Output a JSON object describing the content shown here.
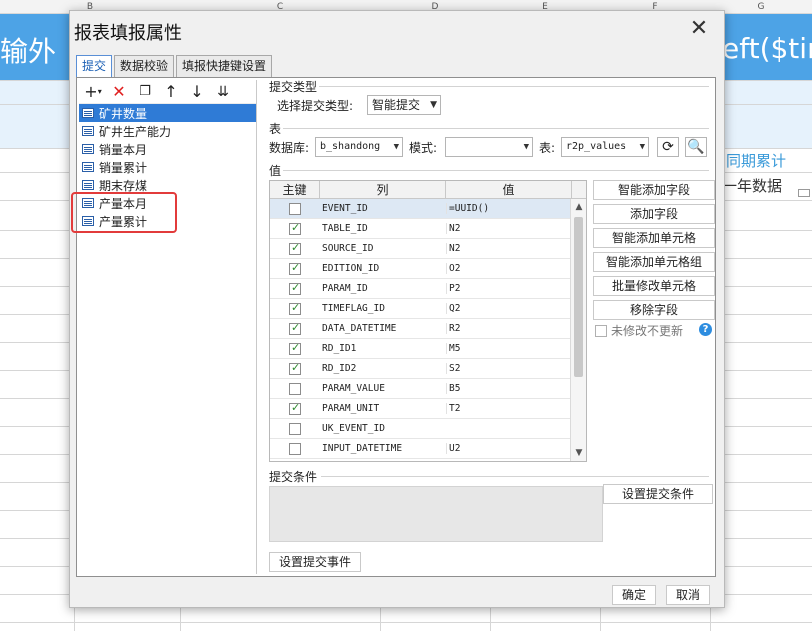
{
  "sheet": {
    "columns": [
      "B",
      "C",
      "D",
      "E",
      "F",
      "G"
    ],
    "band_left_text": "输外（",
    "band_right_text": "eft($tim",
    "right_cell_title": "同期累计",
    "right_cell_text": "一年数据"
  },
  "dialog": {
    "title": "报表填报属性",
    "close_icon": "close-icon",
    "tabs": [
      "提交",
      "数据校验",
      "填报快捷键设置"
    ],
    "toolbar": {
      "icons": [
        "add-icon",
        "delete-icon",
        "copy-icon",
        "move-up-icon",
        "move-down-icon",
        "move-bottom-icon"
      ]
    },
    "tree_items": [
      {
        "label": "矿井数量",
        "selected": true
      },
      {
        "label": "矿井生产能力",
        "selected": false
      },
      {
        "label": "销量本月",
        "selected": false
      },
      {
        "label": "销量累计",
        "selected": false
      },
      {
        "label": "期末存煤",
        "selected": false
      },
      {
        "label": "产量本月",
        "selected": false
      },
      {
        "label": "产量累计",
        "selected": false
      }
    ],
    "submit_type": {
      "section_label": "提交类型",
      "select_label": "选择提交类型:",
      "value": "智能提交"
    },
    "table_section": {
      "section_label": "表",
      "db_label": "数据库:",
      "db_value": "b_shandong",
      "mode_label": "模式:",
      "mode_value": "",
      "table_label": "表:",
      "table_value": "r2p_values"
    },
    "value_section": {
      "section_label": "值",
      "headers": {
        "key": "主键",
        "column": "列",
        "value": "值"
      },
      "rows": [
        {
          "key": false,
          "column": "EVENT_ID",
          "value": "=UUID()"
        },
        {
          "key": true,
          "column": "TABLE_ID",
          "value": "N2"
        },
        {
          "key": true,
          "column": "SOURCE_ID",
          "value": "N2"
        },
        {
          "key": true,
          "column": "EDITION_ID",
          "value": "O2"
        },
        {
          "key": true,
          "column": "PARAM_ID",
          "value": "P2"
        },
        {
          "key": true,
          "column": "TIMEFLAG_ID",
          "value": "Q2"
        },
        {
          "key": true,
          "column": "DATA_DATETIME",
          "value": "R2"
        },
        {
          "key": true,
          "column": "RD_ID1",
          "value": "M5"
        },
        {
          "key": true,
          "column": "RD_ID2",
          "value": "S2"
        },
        {
          "key": false,
          "column": "PARAM_VALUE",
          "value": "B5"
        },
        {
          "key": true,
          "column": "PARAM_UNIT",
          "value": "T2"
        },
        {
          "key": false,
          "column": "UK_EVENT_ID",
          "value": ""
        },
        {
          "key": false,
          "column": "INPUT_DATETIME",
          "value": "U2"
        }
      ],
      "side_buttons": [
        "智能添加字段",
        "添加字段",
        "智能添加单元格",
        "智能添加单元格组",
        "批量修改单元格",
        "移除字段"
      ],
      "unmodified_label": "未修改不更新"
    },
    "condition_section": {
      "section_label": "提交条件",
      "set_button": "设置提交条件"
    },
    "event_button": "设置提交事件",
    "ok_button": "确定",
    "cancel_button": "取消"
  }
}
